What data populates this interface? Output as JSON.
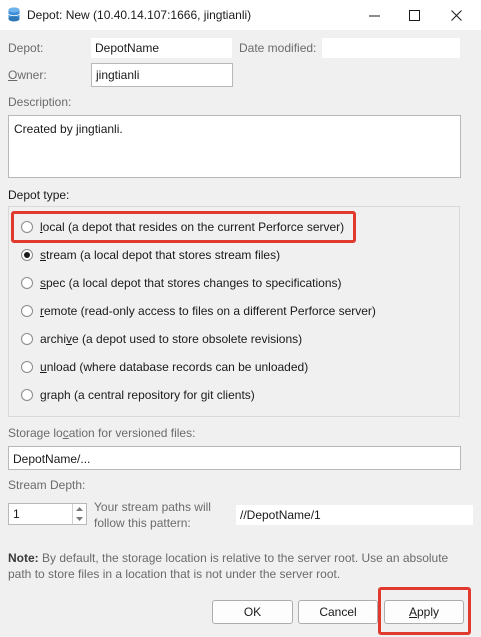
{
  "window": {
    "title": "Depot: New (10.40.14.107:1666,  jingtianli)"
  },
  "form": {
    "depot_label": "Depot:",
    "depot_value": "DepotName",
    "date_modified_label": "Date modified:",
    "date_modified_value": "",
    "owner_label": "Owner:",
    "owner_value": "jingtianli",
    "description_label": "Description:",
    "description_value": "Created by jingtianli.",
    "depot_type_label": "Depot type:",
    "depot_types": [
      {
        "key": "l",
        "rest": "ocal (a depot that resides on the current Perforce server)",
        "checked": false
      },
      {
        "key": "s",
        "rest": "tream (a local depot that stores stream files)",
        "checked": true
      },
      {
        "key": "s",
        "rest": "pec (a local depot that stores changes to specifications)",
        "checked": false
      },
      {
        "key": "r",
        "rest": "emote (read-only access to files on a different Perforce server)",
        "checked": false
      },
      {
        "key": "archi",
        "rest_after": "e (a depot used to store obsolete revisions)",
        "key2": "v",
        "checked": false
      },
      {
        "key": "u",
        "rest": "nload (where database records can be unloaded)",
        "checked": false
      },
      {
        "key": "g",
        "rest": "raph (a central repository for git clients)",
        "checked": false
      }
    ],
    "storage_label_pre": "Storage lo",
    "storage_label_key": "c",
    "storage_label_post": "ation for versioned files:",
    "storage_value": "DepotName/...",
    "stream_depth_label": "Stream Depth:",
    "stream_depth_value": "1",
    "stream_paths_line1": "Your stream paths will",
    "stream_paths_line2": "follow this pattern:",
    "stream_pattern": "//DepotName/1",
    "note_bold": "Note:",
    "note_text": " By default, the storage location is relative to the server root. Use an absolute path to store files in a location that is not under the server root."
  },
  "buttons": {
    "ok": "OK",
    "cancel": "Cancel",
    "apply_key": "A",
    "apply_rest": "pply"
  },
  "colors": {
    "highlight": "#e03a2f",
    "background": "#f0f0f0"
  }
}
